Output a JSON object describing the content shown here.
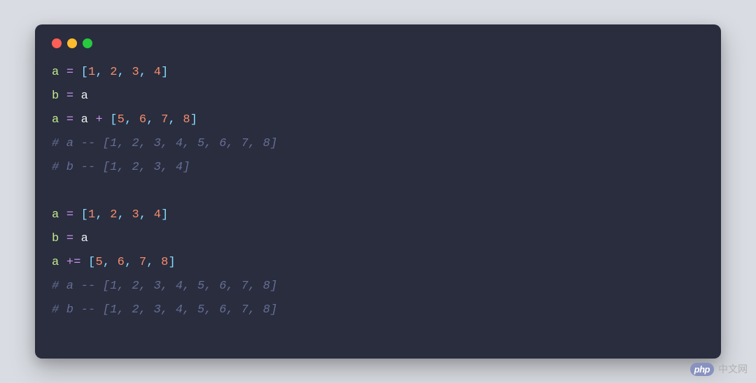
{
  "window": {
    "dots": [
      "red",
      "yellow",
      "green"
    ]
  },
  "code": {
    "lines": [
      [
        {
          "cls": "var-green",
          "text": "a"
        },
        {
          "cls": "variable",
          "text": " "
        },
        {
          "cls": "equals",
          "text": "="
        },
        {
          "cls": "variable",
          "text": " "
        },
        {
          "cls": "bracket",
          "text": "["
        },
        {
          "cls": "number",
          "text": "1"
        },
        {
          "cls": "comma",
          "text": ","
        },
        {
          "cls": "variable",
          "text": " "
        },
        {
          "cls": "number",
          "text": "2"
        },
        {
          "cls": "comma",
          "text": ","
        },
        {
          "cls": "variable",
          "text": " "
        },
        {
          "cls": "number",
          "text": "3"
        },
        {
          "cls": "comma",
          "text": ","
        },
        {
          "cls": "variable",
          "text": " "
        },
        {
          "cls": "number",
          "text": "4"
        },
        {
          "cls": "bracket",
          "text": "]"
        }
      ],
      [
        {
          "cls": "var-green",
          "text": "b"
        },
        {
          "cls": "variable",
          "text": " "
        },
        {
          "cls": "equals",
          "text": "="
        },
        {
          "cls": "variable",
          "text": " a"
        }
      ],
      [
        {
          "cls": "var-green",
          "text": "a"
        },
        {
          "cls": "variable",
          "text": " "
        },
        {
          "cls": "equals",
          "text": "="
        },
        {
          "cls": "variable",
          "text": " a "
        },
        {
          "cls": "plus",
          "text": "+"
        },
        {
          "cls": "variable",
          "text": " "
        },
        {
          "cls": "bracket",
          "text": "["
        },
        {
          "cls": "number",
          "text": "5"
        },
        {
          "cls": "comma",
          "text": ","
        },
        {
          "cls": "variable",
          "text": " "
        },
        {
          "cls": "number",
          "text": "6"
        },
        {
          "cls": "comma",
          "text": ","
        },
        {
          "cls": "variable",
          "text": " "
        },
        {
          "cls": "number",
          "text": "7"
        },
        {
          "cls": "comma",
          "text": ","
        },
        {
          "cls": "variable",
          "text": " "
        },
        {
          "cls": "number",
          "text": "8"
        },
        {
          "cls": "bracket",
          "text": "]"
        }
      ],
      [
        {
          "cls": "comment",
          "text": "# a -- [1, 2, 3, 4, 5, 6, 7, 8]"
        }
      ],
      [
        {
          "cls": "comment",
          "text": "# b -- [1, 2, 3, 4]"
        }
      ],
      [],
      [
        {
          "cls": "var-green",
          "text": "a"
        },
        {
          "cls": "variable",
          "text": " "
        },
        {
          "cls": "equals",
          "text": "="
        },
        {
          "cls": "variable",
          "text": " "
        },
        {
          "cls": "bracket",
          "text": "["
        },
        {
          "cls": "number",
          "text": "1"
        },
        {
          "cls": "comma",
          "text": ","
        },
        {
          "cls": "variable",
          "text": " "
        },
        {
          "cls": "number",
          "text": "2"
        },
        {
          "cls": "comma",
          "text": ","
        },
        {
          "cls": "variable",
          "text": " "
        },
        {
          "cls": "number",
          "text": "3"
        },
        {
          "cls": "comma",
          "text": ","
        },
        {
          "cls": "variable",
          "text": " "
        },
        {
          "cls": "number",
          "text": "4"
        },
        {
          "cls": "bracket",
          "text": "]"
        }
      ],
      [
        {
          "cls": "var-green",
          "text": "b"
        },
        {
          "cls": "variable",
          "text": " "
        },
        {
          "cls": "equals",
          "text": "="
        },
        {
          "cls": "variable",
          "text": " a"
        }
      ],
      [
        {
          "cls": "var-green",
          "text": "a"
        },
        {
          "cls": "variable",
          "text": " "
        },
        {
          "cls": "plus",
          "text": "+="
        },
        {
          "cls": "variable",
          "text": " "
        },
        {
          "cls": "bracket",
          "text": "["
        },
        {
          "cls": "number",
          "text": "5"
        },
        {
          "cls": "comma",
          "text": ","
        },
        {
          "cls": "variable",
          "text": " "
        },
        {
          "cls": "number",
          "text": "6"
        },
        {
          "cls": "comma",
          "text": ","
        },
        {
          "cls": "variable",
          "text": " "
        },
        {
          "cls": "number",
          "text": "7"
        },
        {
          "cls": "comma",
          "text": ","
        },
        {
          "cls": "variable",
          "text": " "
        },
        {
          "cls": "number",
          "text": "8"
        },
        {
          "cls": "bracket",
          "text": "]"
        }
      ],
      [
        {
          "cls": "comment",
          "text": "# a -- [1, 2, 3, 4, 5, 6, 7, 8]"
        }
      ],
      [
        {
          "cls": "comment",
          "text": "# b -- [1, 2, 3, 4, 5, 6, 7, 8]"
        }
      ]
    ]
  },
  "watermark": {
    "badge": "php",
    "text": "中文网"
  }
}
